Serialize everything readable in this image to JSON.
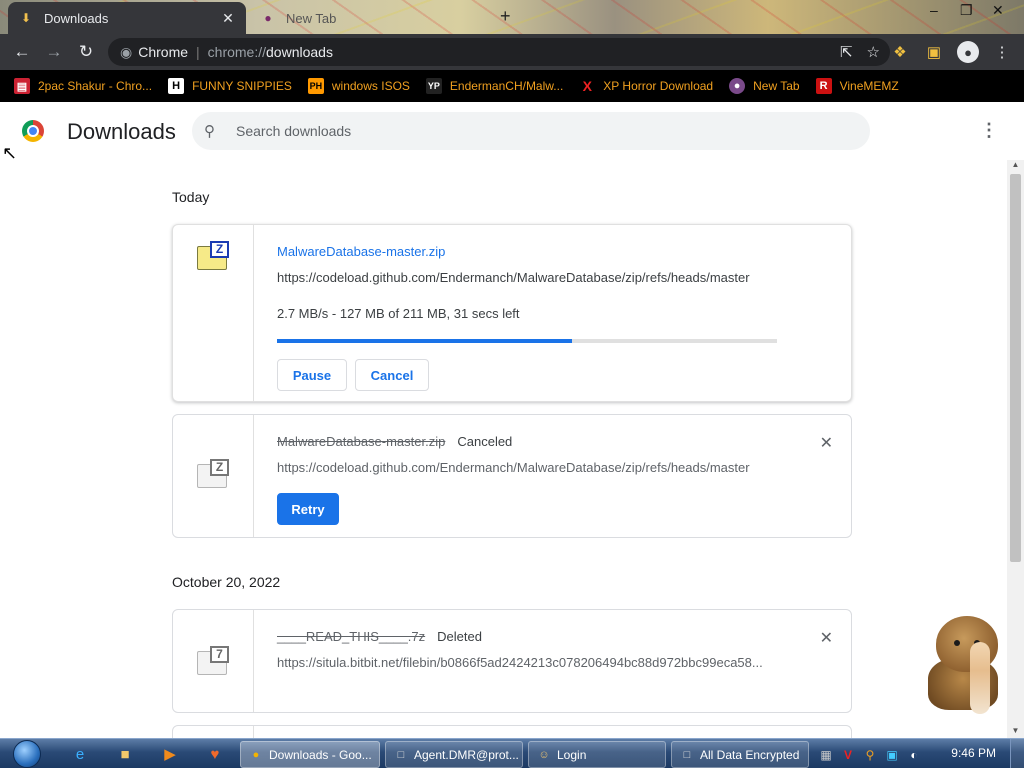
{
  "tabs": [
    {
      "title": "Downloads",
      "active": true
    },
    {
      "title": "New Tab",
      "active": false
    }
  ],
  "omnibox": {
    "site_label": "Chrome",
    "url_scheme": "chrome://",
    "url_path": "downloads"
  },
  "bookmarks": [
    {
      "label": "2pac Shakur - Chro...",
      "icon": "pdf-icon"
    },
    {
      "label": "FUNNY SNIPPIES",
      "icon": "h-icon"
    },
    {
      "label": "windows ISOS",
      "icon": "ph-icon"
    },
    {
      "label": "EndermanCH/Malw...",
      "icon": "yp-icon"
    },
    {
      "label": "XP Horror Download",
      "icon": "x-icon"
    },
    {
      "label": "New Tab",
      "icon": "globe-icon"
    },
    {
      "label": "VineMEMZ",
      "icon": "r-icon"
    }
  ],
  "page": {
    "title": "Downloads",
    "search_placeholder": "Search downloads"
  },
  "groups": [
    {
      "heading": "Today"
    },
    {
      "heading": "October 20, 2022"
    }
  ],
  "downloads": [
    {
      "filename": "MalwareDatabase-master.zip",
      "url": "https://codeload.github.com/Endermanch/MalwareDatabase/zip/refs/heads/master",
      "progress_text": "2.7 MB/s - 127 MB of 211 MB, 31 secs left",
      "progress": 0.59,
      "pause_label": "Pause",
      "cancel_label": "Cancel"
    },
    {
      "filename": "MalwareDatabase-master.zip",
      "status": "Canceled",
      "url": "https://codeload.github.com/Endermanch/MalwareDatabase/zip/refs/heads/master",
      "retry_label": "Retry"
    },
    {
      "filename": "____READ_THIS____.7z",
      "status": "Deleted",
      "url": "https://situla.bitbit.net/filebin/b0866f5ad2424213c078206494bc88d972bbc99eca58..."
    }
  ],
  "taskbar": {
    "tasks": [
      {
        "label": "Downloads - Goo...",
        "icon": "chrome-icon",
        "active": true
      },
      {
        "label": "Agent.DMR@prot...",
        "icon": "window-icon",
        "active": false
      },
      {
        "label": "Login",
        "icon": "user-icon",
        "active": false
      },
      {
        "label": "All Data Encrypted",
        "icon": "window-icon",
        "active": false
      }
    ],
    "clock": "9:46 PM"
  },
  "colors": {
    "accent": "#1a73e8",
    "bookmark_text": "#f0a020",
    "toolbar": "#35363a"
  }
}
